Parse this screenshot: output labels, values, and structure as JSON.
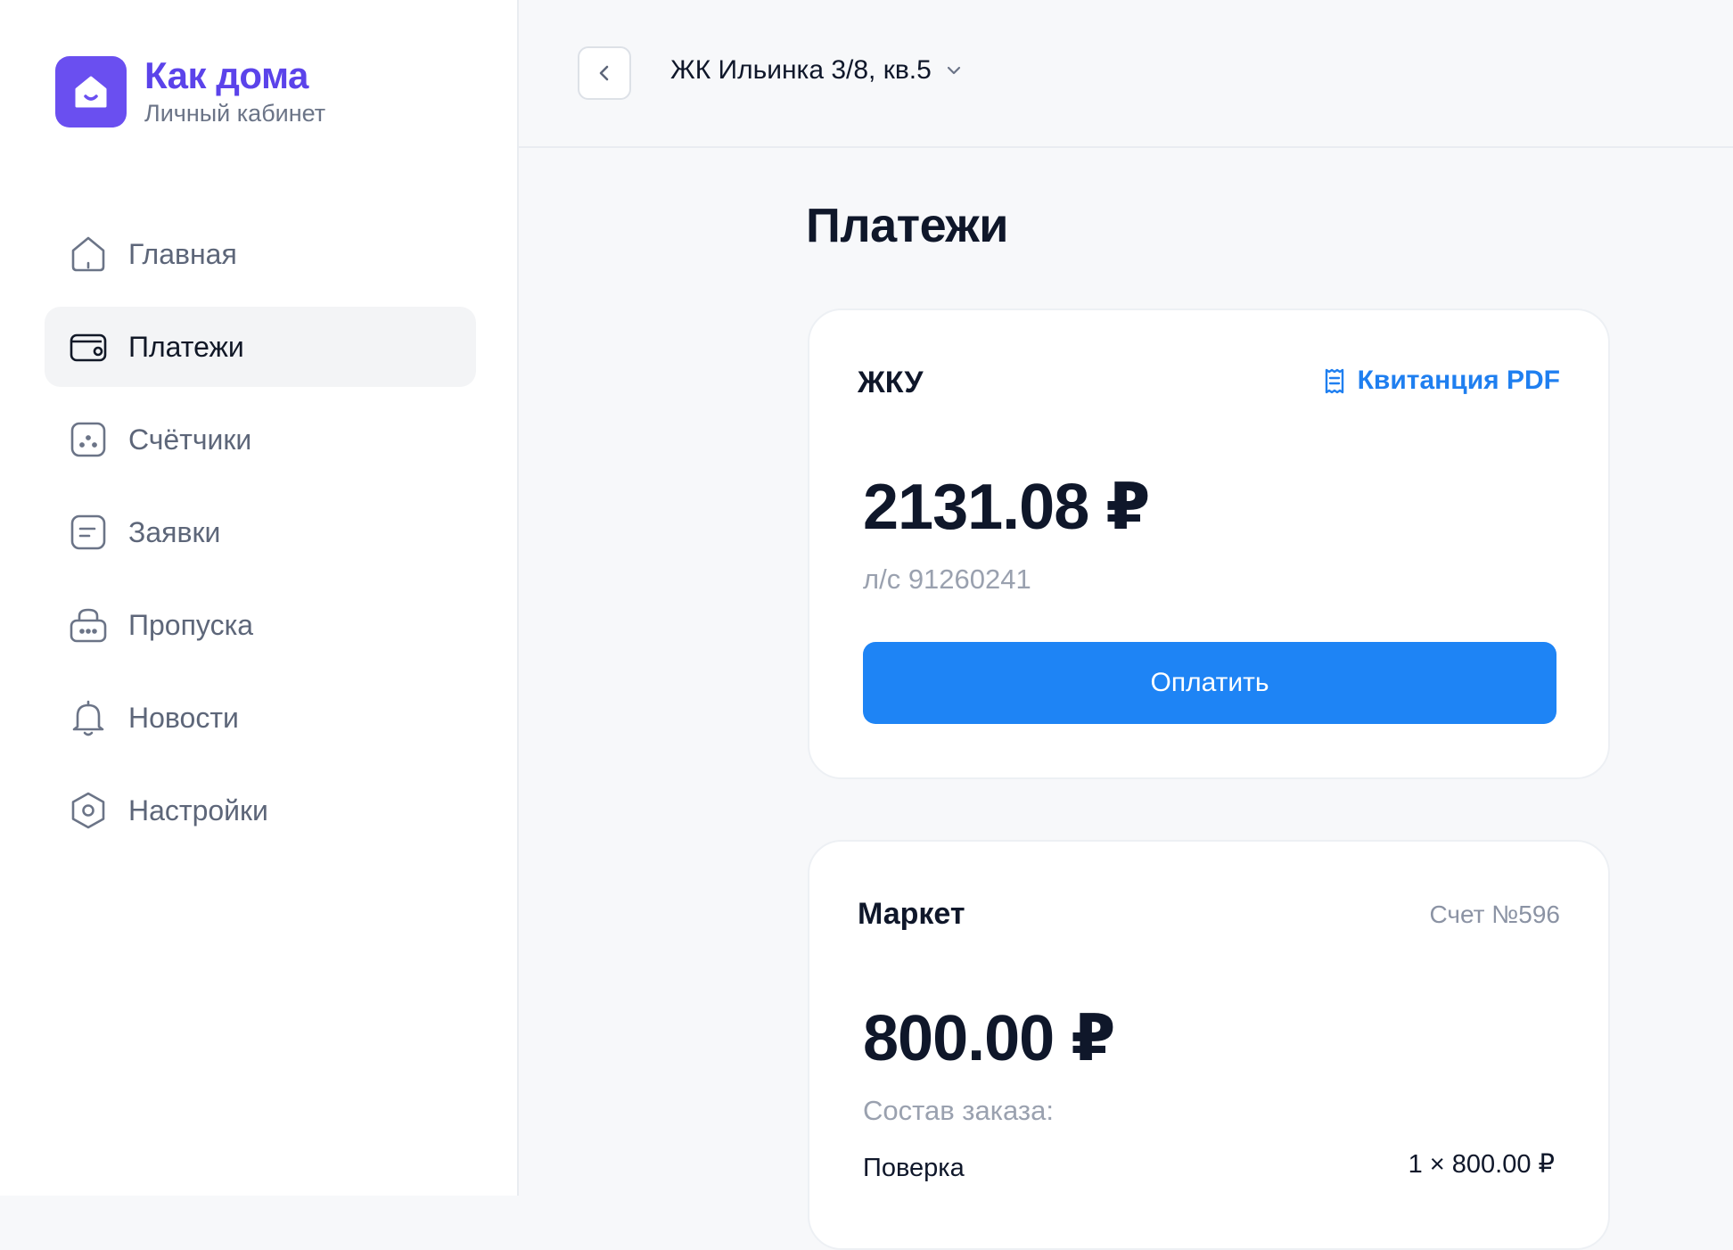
{
  "brand": {
    "title": "Как дома",
    "subtitle": "Личный кабинет",
    "logo_icon": "house-smile-icon"
  },
  "sidebar": {
    "items": [
      {
        "label": "Главная",
        "icon": "home-icon",
        "active": false
      },
      {
        "label": "Платежи",
        "icon": "wallet-icon",
        "active": true
      },
      {
        "label": "Счётчики",
        "icon": "dice-icon",
        "active": false
      },
      {
        "label": "Заявки",
        "icon": "document-icon",
        "active": false
      },
      {
        "label": "Пропуска",
        "icon": "lock-icon",
        "active": false
      },
      {
        "label": "Новости",
        "icon": "bell-icon",
        "active": false
      },
      {
        "label": "Настройки",
        "icon": "hexagon-icon",
        "active": false
      }
    ]
  },
  "header": {
    "address": "ЖК Ильинка 3/8, кв.5"
  },
  "page": {
    "title": "Платежи"
  },
  "cards": {
    "utilities": {
      "title": "ЖКУ",
      "link_label": "Квитанция PDF",
      "amount": "2131.08 ₽",
      "account": "л/с 91260241",
      "pay_label": "Оплатить"
    },
    "market": {
      "title": "Маркет",
      "invoice": "Счет №596",
      "amount": "800.00 ₽",
      "order_label": "Состав заказа:",
      "items": [
        {
          "name": "Поверка",
          "price": "1 × 800.00 ₽"
        }
      ]
    }
  },
  "colors": {
    "brand": "#5b43ea",
    "primary": "#1e84f5",
    "text": "#0f172a",
    "muted": "#8b93a4"
  }
}
